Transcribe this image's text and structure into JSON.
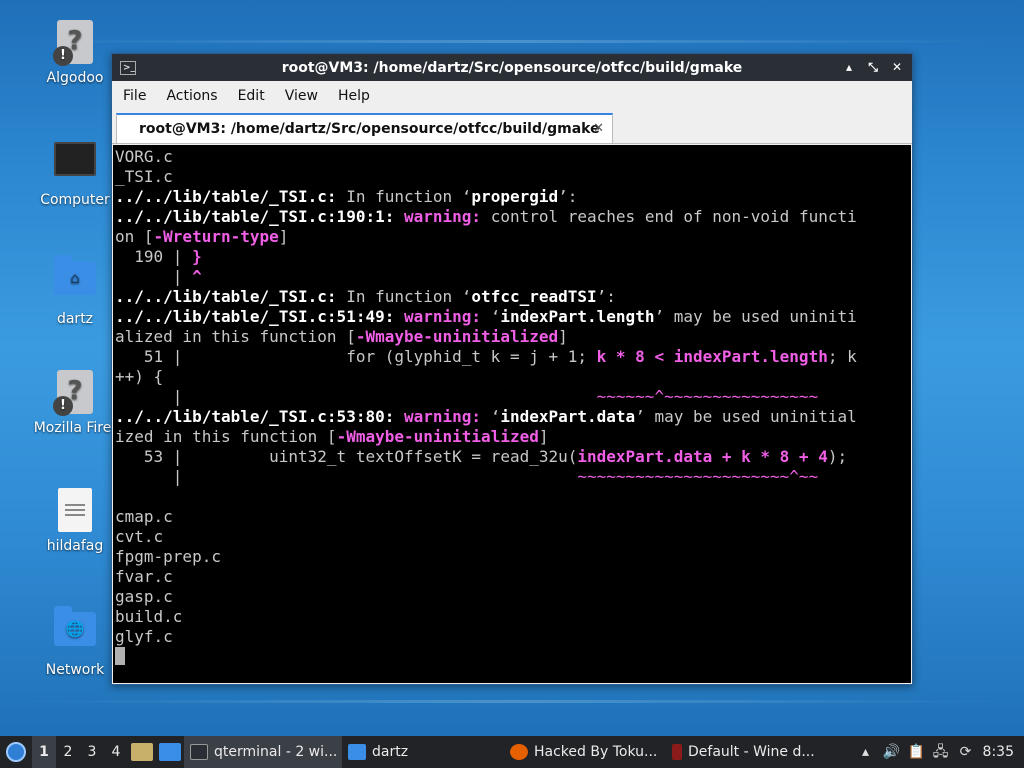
{
  "desktop": {
    "icons": [
      {
        "label": "Algodoo",
        "badge": "!"
      },
      {
        "label": "Computer"
      },
      {
        "label": "dartz"
      },
      {
        "label": "Mozilla Firef",
        "badge": "!"
      },
      {
        "label": "hildafag"
      },
      {
        "label": "Network"
      }
    ]
  },
  "window": {
    "title": "root@VM3: /home/dartz/Src/opensource/otfcc/build/gmake",
    "controls": {
      "minimize": "▴",
      "maximize": "⤡",
      "close": "✕"
    },
    "menu": [
      "File",
      "Actions",
      "Edit",
      "View",
      "Help"
    ],
    "tab": {
      "label": "root@VM3: /home/dartz/Src/opensource/otfcc/build/gmake",
      "close": "✕"
    }
  },
  "terminal": {
    "lines": [
      [
        {
          "t": "VORG.c"
        }
      ],
      [
        {
          "t": "_TSI.c"
        }
      ],
      [
        {
          "t": "../../lib/table/_TSI.c:",
          "s": "b"
        },
        {
          "t": " In function ‘"
        },
        {
          "t": "propergid",
          "s": "b"
        },
        {
          "t": "’:"
        }
      ],
      [
        {
          "t": "../../lib/table/_TSI.c:190:1:",
          "s": "b"
        },
        {
          "t": " "
        },
        {
          "t": "warning:",
          "s": "w"
        },
        {
          "t": " control reaches end of non-void functi"
        }
      ],
      [
        {
          "t": "on ["
        },
        {
          "t": "-Wreturn-type",
          "s": "w"
        },
        {
          "t": "]"
        }
      ],
      [
        {
          "t": "  190 | "
        },
        {
          "t": "}",
          "s": "w"
        }
      ],
      [
        {
          "t": "      | "
        },
        {
          "t": "^",
          "s": "w"
        }
      ],
      [
        {
          "t": "../../lib/table/_TSI.c:",
          "s": "b"
        },
        {
          "t": " In function ‘"
        },
        {
          "t": "otfcc_readTSI",
          "s": "b"
        },
        {
          "t": "’:"
        }
      ],
      [
        {
          "t": "../../lib/table/_TSI.c:51:49:",
          "s": "b"
        },
        {
          "t": " "
        },
        {
          "t": "warning:",
          "s": "w"
        },
        {
          "t": " ‘"
        },
        {
          "t": "indexPart.length",
          "s": "b"
        },
        {
          "t": "’ may be used uniniti"
        }
      ],
      [
        {
          "t": "alized in this function ["
        },
        {
          "t": "-Wmaybe-uninitialized",
          "s": "w"
        },
        {
          "t": "]"
        }
      ],
      [
        {
          "t": "   51 |                 for (glyphid_t k = j + 1; "
        },
        {
          "t": "k * 8 < indexPart.length",
          "s": "w"
        },
        {
          "t": "; k"
        }
      ],
      [
        {
          "t": "++) {"
        }
      ],
      [
        {
          "t": "      |                                           "
        },
        {
          "t": "~~~~~~^~~~~~~~~~~~~~~~~",
          "s": "m"
        }
      ],
      [
        {
          "t": "../../lib/table/_TSI.c:53:80:",
          "s": "b"
        },
        {
          "t": " "
        },
        {
          "t": "warning:",
          "s": "w"
        },
        {
          "t": " ‘"
        },
        {
          "t": "indexPart.data",
          "s": "b"
        },
        {
          "t": "’ may be used uninitial"
        }
      ],
      [
        {
          "t": "ized in this function ["
        },
        {
          "t": "-Wmaybe-uninitialized",
          "s": "w"
        },
        {
          "t": "]"
        }
      ],
      [
        {
          "t": "   53 |         uint32_t textOffsetK = read_32u("
        },
        {
          "t": "indexPart.data + k * 8 + 4",
          "s": "w"
        },
        {
          "t": ");"
        }
      ],
      [
        {
          "t": "      |                                         "
        },
        {
          "t": "~~~~~~~~~~~~~~~~~~~~~~^~~",
          "s": "m"
        }
      ],
      [
        {
          "t": ""
        }
      ],
      [
        {
          "t": "cmap.c"
        }
      ],
      [
        {
          "t": "cvt.c"
        }
      ],
      [
        {
          "t": "fpgm-prep.c"
        }
      ],
      [
        {
          "t": "fvar.c"
        }
      ],
      [
        {
          "t": "gasp.c"
        }
      ],
      [
        {
          "t": "build.c"
        }
      ],
      [
        {
          "t": "glyf.c"
        }
      ]
    ]
  },
  "taskbar": {
    "workspaces": [
      "1",
      "2",
      "3",
      "4"
    ],
    "tasks": [
      {
        "label": "qterminal - 2 wi...",
        "color": "#2a2f36"
      },
      {
        "label": "dartz",
        "color": "#3a8ee6"
      },
      {
        "label": "Hacked By Toku...",
        "color": "#e66000"
      },
      {
        "label": "Default - Wine d...",
        "color": "#8b1a1a"
      }
    ],
    "clock": "8:35"
  }
}
